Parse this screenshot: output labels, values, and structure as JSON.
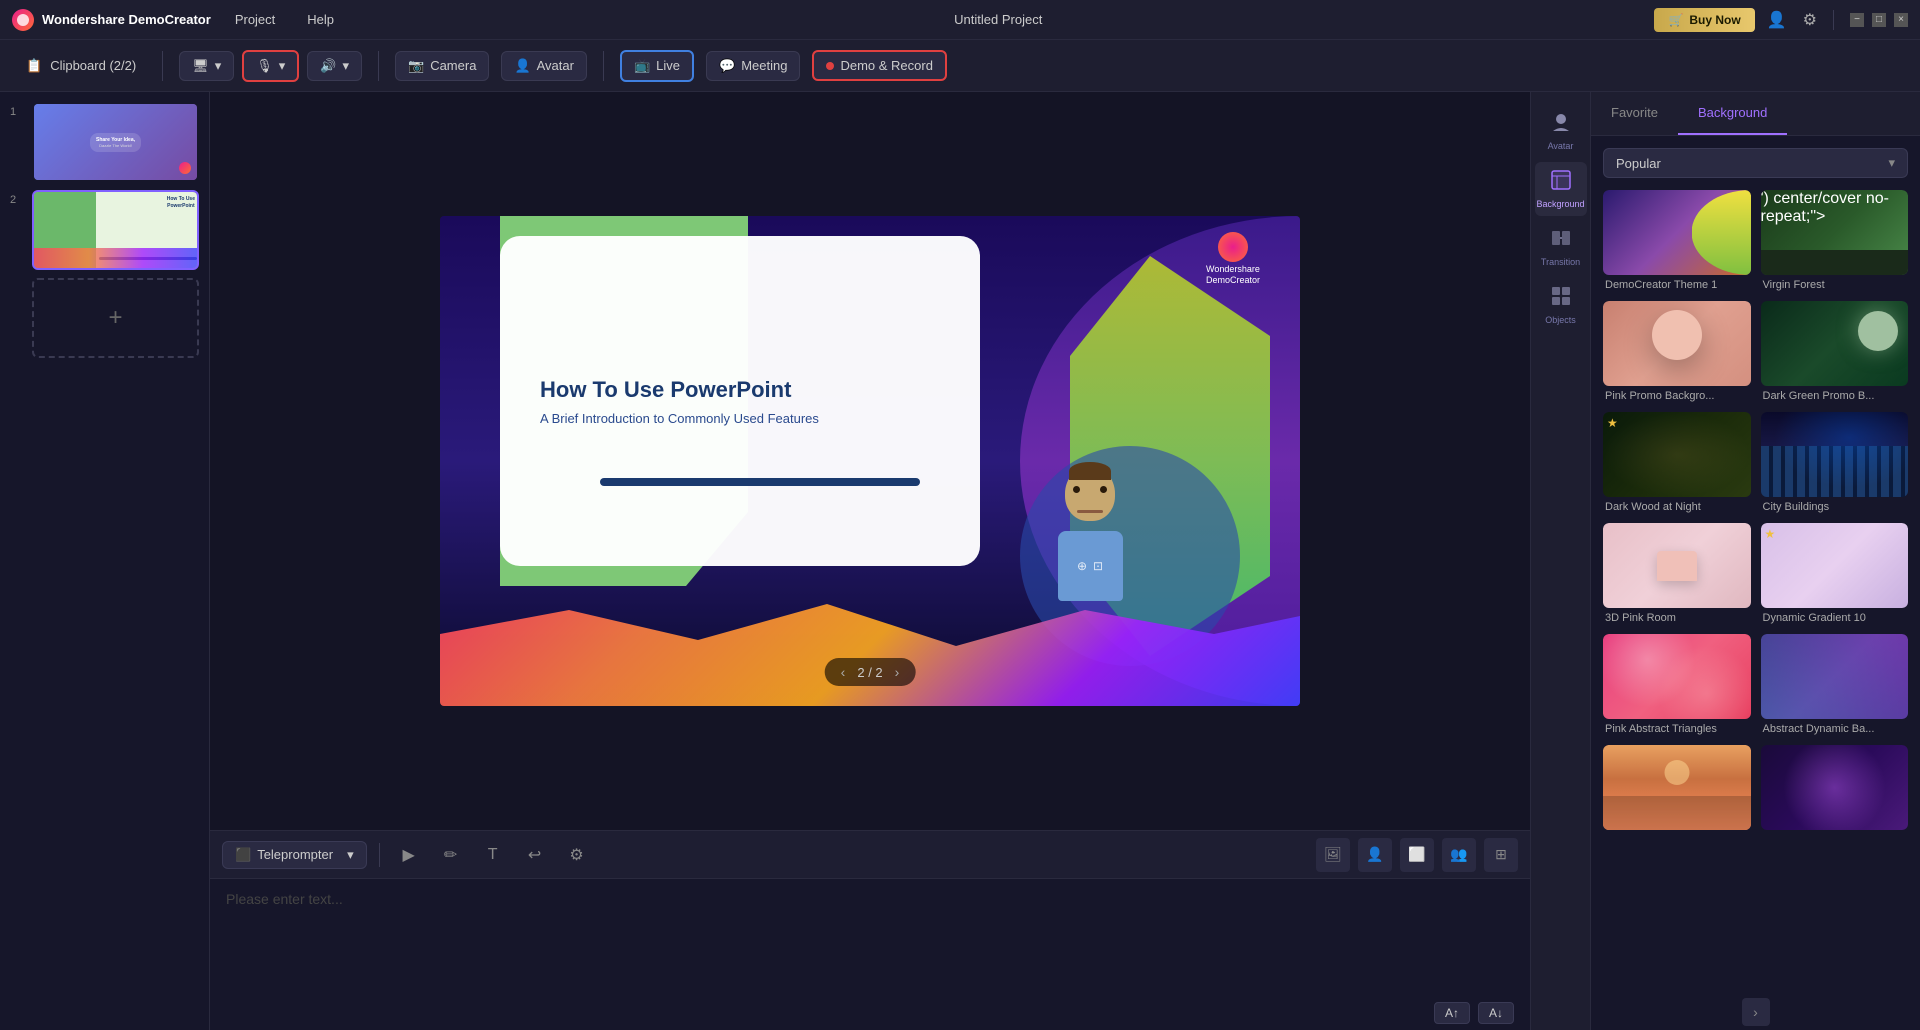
{
  "app": {
    "name": "Wondershare DemoCreator",
    "logo_text": "W",
    "title": "Untitled Project"
  },
  "menu": {
    "items": [
      "Project",
      "Help"
    ]
  },
  "titlebar": {
    "buy_now": "Buy Now",
    "controls": [
      "−",
      "□",
      "×"
    ]
  },
  "toolbar": {
    "clipboard_label": "Clipboard (2/2)",
    "camera_label": "Camera",
    "avatar_label": "Avatar",
    "live_label": "Live",
    "meeting_label": "Meeting",
    "record_label": "Demo & Record"
  },
  "slides": {
    "items": [
      {
        "number": "1",
        "title": "Share Your Idea, Dazzle The World!"
      },
      {
        "number": "2",
        "title": "How To Use PowerPoint"
      }
    ],
    "add_label": "+"
  },
  "preview": {
    "slide_title": "How To Use PowerPoint",
    "slide_subtitle": "A Brief Introduction to Commonly Used Features",
    "logo_text": "Wondershare\nDemoCreator",
    "nav_current": "2 / 2"
  },
  "teleprompter": {
    "mode_label": "Teleprompter",
    "placeholder": "Please enter text...",
    "font_increase": "A↑",
    "font_decrease": "A↓"
  },
  "right_panel": {
    "tabs": [
      "Favorite",
      "Background"
    ],
    "active_tab": "Background",
    "filter": {
      "label": "Popular"
    },
    "tools": [
      {
        "label": "Avatar",
        "icon": "👤"
      },
      {
        "label": "Background",
        "icon": "🖼"
      },
      {
        "label": "Transition",
        "icon": "▶"
      },
      {
        "label": "Objects",
        "icon": "⊞"
      }
    ],
    "backgrounds": [
      {
        "id": "bg1",
        "label": "DemoCreator Theme 1",
        "style": "democreator",
        "favorite": false
      },
      {
        "id": "bg2",
        "label": "Virgin Forest",
        "style": "virgin-forest",
        "favorite": false
      },
      {
        "id": "bg3",
        "label": "Pink Promo Backgro...",
        "style": "pink-promo",
        "favorite": false
      },
      {
        "id": "bg4",
        "label": "Dark Green Promo B...",
        "style": "dark-green",
        "favorite": false
      },
      {
        "id": "bg5",
        "label": "Dark Wood at Night",
        "style": "dark-wood",
        "favorite": true
      },
      {
        "id": "bg6",
        "label": "City Buildings",
        "style": "city-buildings",
        "favorite": false
      },
      {
        "id": "bg7",
        "label": "3D Pink Room",
        "style": "3d-pink",
        "favorite": false
      },
      {
        "id": "bg8",
        "label": "Dynamic Gradient 10",
        "style": "dynamic-10",
        "favorite": true
      },
      {
        "id": "bg9",
        "label": "Pink Abstract Triangles",
        "style": "pink-abstract",
        "favorite": false
      },
      {
        "id": "bg10",
        "label": "Abstract Dynamic Ba...",
        "style": "abstract-dynamic",
        "favorite": false
      },
      {
        "id": "bg11",
        "label": "",
        "style": "bottom-1",
        "favorite": false
      },
      {
        "id": "bg12",
        "label": "",
        "style": "bottom-2",
        "favorite": false
      }
    ]
  }
}
